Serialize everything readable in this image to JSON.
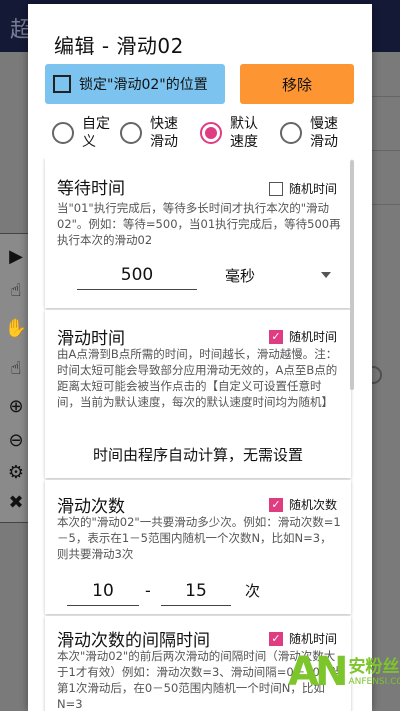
{
  "background": {
    "title_fragment": "超"
  },
  "dialog": {
    "title": "编辑 - 滑动02",
    "lock_label": "锁定\"滑动02\"的位置",
    "remove_label": "移除"
  },
  "speed_options": [
    {
      "label": "自定义",
      "checked": false
    },
    {
      "label": "快速滑动",
      "checked": false
    },
    {
      "label": "默认速度",
      "checked": true
    },
    {
      "label": "慢速滑动",
      "checked": false
    }
  ],
  "wait": {
    "title": "等待时间",
    "toggle_label": "随机时间",
    "toggle_checked": false,
    "desc": "当\"01\"执行完成后，等待多长时间才执行本次的\"滑动02\"。例如：等待=500，当01执行完成后，等待500再执行本次的滑动02",
    "value": "500",
    "unit": "毫秒"
  },
  "slide_time": {
    "title": "滑动时间",
    "toggle_label": "随机时间",
    "toggle_checked": true,
    "desc": "由A点滑到B点所需的时间，时间越长，滑动越慢。注：时间太短可能会导致部分应用滑动无效的，A点至B点的距离太短可能会被当作点击的【自定义可设置任意时间，当前为默认速度，每次的默认速度时间均为随机】",
    "auto_text": "时间由程序自动计算，无需设置"
  },
  "slide_count": {
    "title": "滑动次数",
    "toggle_label": "随机次数",
    "toggle_checked": true,
    "desc": "本次的\"滑动02\"一共要滑动多少次。例如：滑动次数=1－5，表示在1－5范围内随机一个次数N，比如N=3，则共要滑动3次",
    "min": "10",
    "dash": "-",
    "max": "15",
    "unit": "次"
  },
  "slide_interval": {
    "title": "滑动次数的间隔时间",
    "toggle_label": "随机时间",
    "toggle_checked": true,
    "desc": "本次\"滑动02\"的前后两次滑动的间隔时间（滑动次数大于1才有效）例如：滑动次数=3、滑动间隔=0－50，当第1次滑动后，在0－50范围内随机一个时间N，比如N=3"
  },
  "watermark": {
    "logo": "AN",
    "cn": "安粉丝",
    "en": "ANFENSI.COM"
  }
}
